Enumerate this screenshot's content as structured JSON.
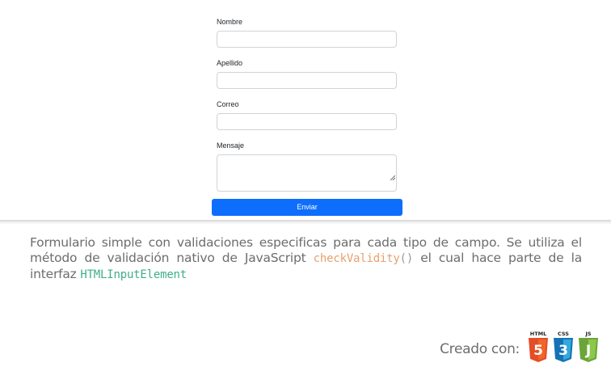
{
  "form": {
    "fields": [
      {
        "label": "Nombre",
        "value": ""
      },
      {
        "label": "Apellido",
        "value": ""
      },
      {
        "label": "Correo",
        "value": ""
      },
      {
        "label": "Mensaje",
        "value": ""
      }
    ],
    "submit_label": "Enviar"
  },
  "description": {
    "text_1": "Formulario simple con validaciones especificas para cada tipo de campo. Se utiliza el método de validación nativo de JavaScript",
    "code_1": "checkValidity",
    "code_1_parens": "()",
    "text_2": "el cual hace parte de la interfaz",
    "code_2": "HTMLInputElement"
  },
  "credits": {
    "label": "Creado con:",
    "logos": [
      {
        "icon": "html5-logo-icon",
        "caption": "HTML",
        "glyph": "5",
        "color": "#e44d26"
      },
      {
        "icon": "css3-logo-icon",
        "caption": "CSS",
        "glyph": "3",
        "color": "#1572b6"
      },
      {
        "icon": "javascript-logo-icon",
        "caption": "JS",
        "glyph": "J",
        "color": "#8cc84b"
      }
    ]
  },
  "colors": {
    "primary_button": "#0d6efd",
    "code_orange": "#e8a070",
    "code_teal": "#3fae8c"
  }
}
